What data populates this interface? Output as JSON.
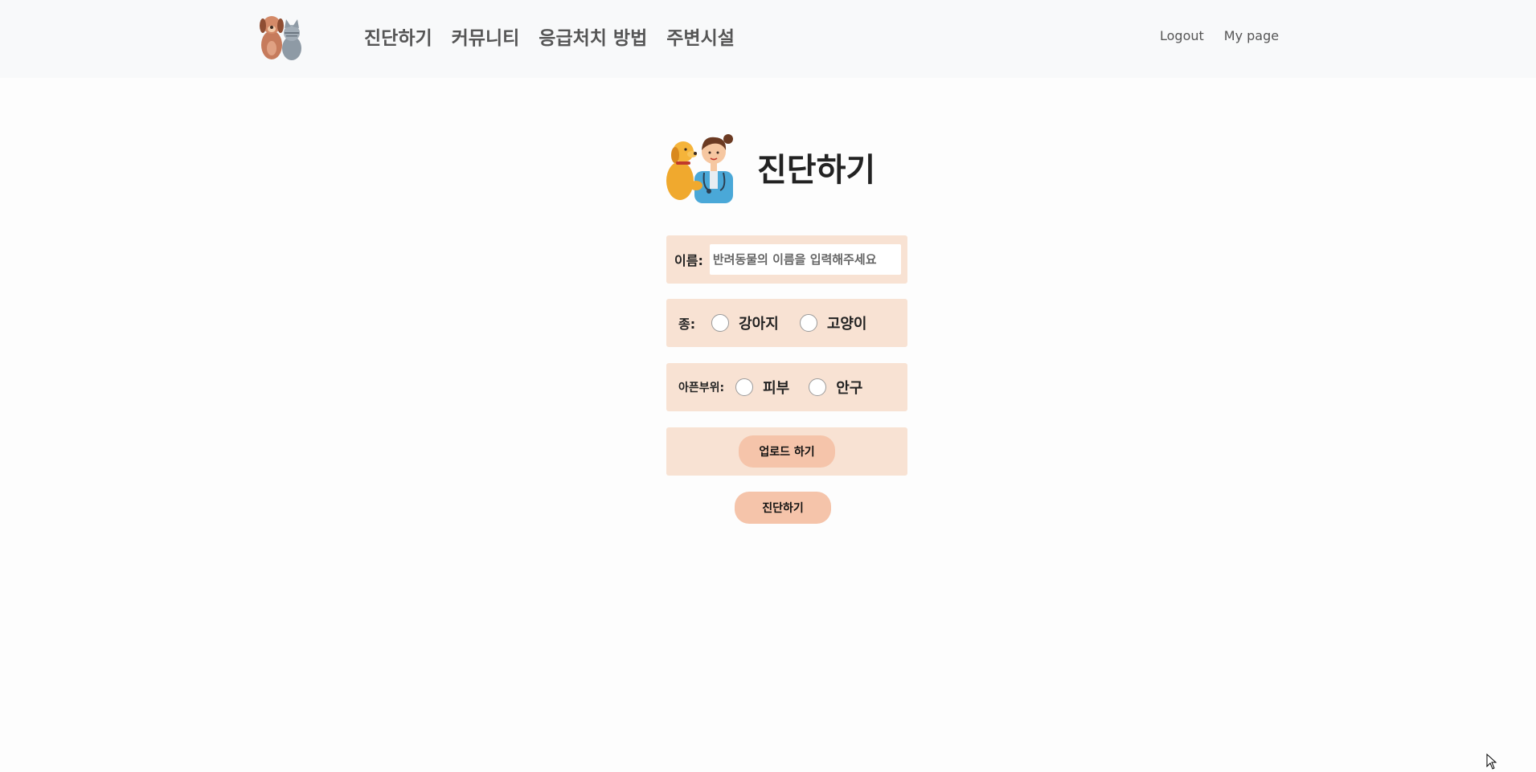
{
  "nav": {
    "links": [
      "진단하기",
      "커뮤니티",
      "응급처치 방법",
      "주변시설"
    ],
    "right": [
      "Logout",
      "My page"
    ],
    "logo_icon": "dog-cat-logo-icon"
  },
  "main": {
    "title": "진단하기",
    "illustration_icon": "vet-with-dog-icon",
    "name_row": {
      "label": "이름:",
      "placeholder": "반려동물의 이름을 입력해주세요",
      "value": ""
    },
    "species_row": {
      "label": "종:",
      "options": [
        "강아지",
        "고양이"
      ]
    },
    "area_row": {
      "label": "아픈부위:",
      "options": [
        "피부",
        "안구"
      ]
    },
    "upload_label": "업로드 하기",
    "diagnose_label": "진단하기"
  },
  "colors": {
    "row_background": "#f8e2d3",
    "button_background": "#f5c4aa",
    "navbar_background": "#f8f9fa"
  }
}
